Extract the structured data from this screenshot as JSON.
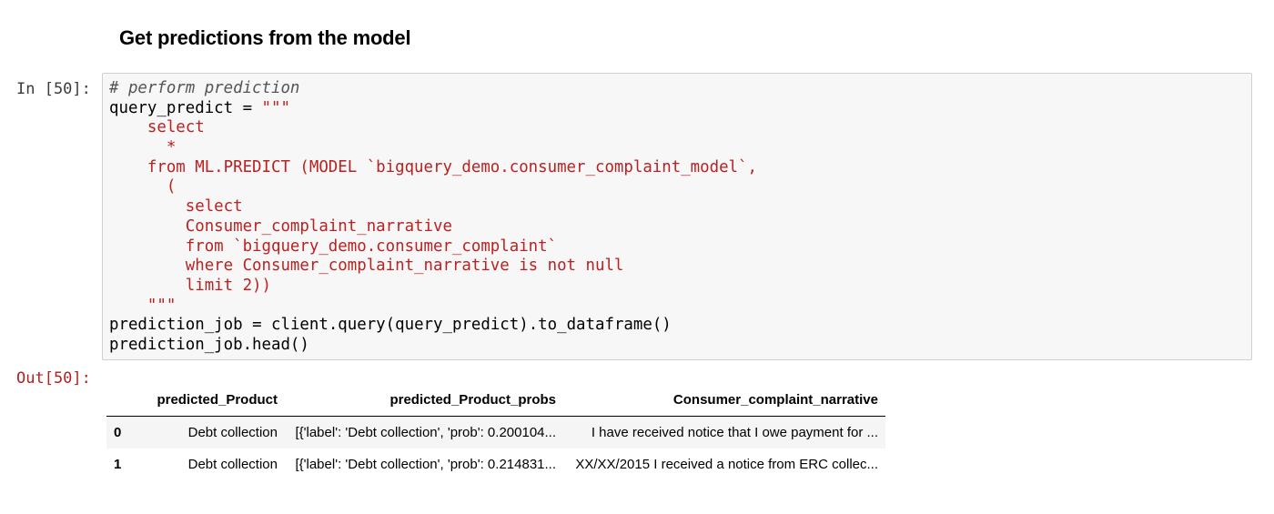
{
  "heading": "Get predictions from the model",
  "input_prompt": "In [50]:",
  "output_prompt": "Out[50]:",
  "code_lines": [
    [
      {
        "t": "# perform prediction",
        "c": "c-comment"
      }
    ],
    [
      {
        "t": "query_predict ",
        "c": "c-plain"
      },
      {
        "t": "=",
        "c": "c-op"
      },
      {
        "t": " \"\"\"",
        "c": "c-str"
      }
    ],
    [
      {
        "t": "    select",
        "c": "c-str"
      }
    ],
    [
      {
        "t": "      *",
        "c": "c-str"
      }
    ],
    [
      {
        "t": "    from ML.PREDICT (MODEL `bigquery_demo.consumer_complaint_model`,",
        "c": "c-str"
      }
    ],
    [
      {
        "t": "      (",
        "c": "c-str"
      }
    ],
    [
      {
        "t": "        select",
        "c": "c-str"
      }
    ],
    [
      {
        "t": "        Consumer_complaint_narrative",
        "c": "c-str"
      }
    ],
    [
      {
        "t": "        from `bigquery_demo.consumer_complaint`",
        "c": "c-str"
      }
    ],
    [
      {
        "t": "        where Consumer_complaint_narrative is not null",
        "c": "c-str"
      }
    ],
    [
      {
        "t": "        limit 2))",
        "c": "c-str"
      }
    ],
    [
      {
        "t": "    \"\"\"",
        "c": "c-str"
      }
    ],
    [
      {
        "t": "prediction_job ",
        "c": "c-plain"
      },
      {
        "t": "=",
        "c": "c-op"
      },
      {
        "t": " client.query(query_predict).to_dataframe()",
        "c": "c-plain"
      }
    ],
    [
      {
        "t": "prediction_job.head()",
        "c": "c-plain"
      }
    ]
  ],
  "table": {
    "columns": [
      "",
      "predicted_Product",
      "predicted_Product_probs",
      "Consumer_complaint_narrative"
    ],
    "rows": [
      [
        "0",
        "Debt collection",
        "[{'label': 'Debt collection', 'prob': 0.200104...",
        "I have received notice that I owe payment for ..."
      ],
      [
        "1",
        "Debt collection",
        "[{'label': 'Debt collection', 'prob': 0.214831...",
        "XX/XX/2015 I received a notice from ERC collec..."
      ]
    ]
  }
}
